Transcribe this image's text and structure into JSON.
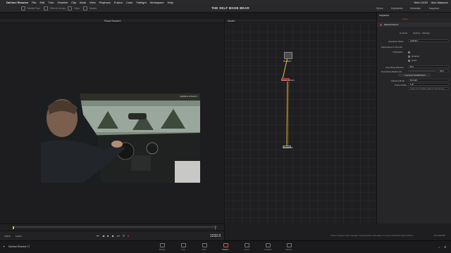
{
  "menubar": {
    "app": "DaVinci Resolve",
    "items": [
      "File",
      "Edit",
      "Trim",
      "Timeline",
      "Clip",
      "Mark",
      "View",
      "Playback",
      "Fusion",
      "Color",
      "Fairlight",
      "Workspace",
      "Help"
    ],
    "clock": "Wed 13:59",
    "user": "Alex Makarov"
  },
  "toolbar": {
    "media_pool": "Media Pool",
    "effects": "Effects Library",
    "clips": "Clips",
    "nodes": "Nodes",
    "project_title": "THE SELF MADE BEAR",
    "edited": "Edited",
    "right": [
      "Spline",
      "Keyframes",
      "Metadata",
      "Inspector"
    ]
  },
  "viewer": {
    "title": "PlanarTracker1",
    "tracker_label": "MediaIn1+PlanarT..."
  },
  "nodes": {
    "title": "Nodes",
    "items": [
      "MediaIn1",
      "PlanarTracker1",
      "MediaOut1"
    ]
  },
  "inspector": {
    "title": "Inspector",
    "tab_label": "Tools",
    "node_name": "PlanarTracker1",
    "subtabs": [
      "Controls",
      "Options",
      "Settings"
    ],
    "operation_mode_label": "Operation Mode",
    "operation_mode_value": "Stabilize",
    "section_label": "Parameters to Smooth",
    "params": [
      "Translation",
      "Rotation",
      "Scale"
    ],
    "smoothing_window_label": "Smoothing Window",
    "smoothing_window_value": "Box",
    "smoothing_radius_label": "Smoothing Radius (Fr...",
    "smoothing_radius_value": "30.0",
    "compute_btn": "Compute Stabilization",
    "clipping_mode_label": "Clipping Mode",
    "clipping_mode_value": "Domain",
    "frame_mode_label": "Frame Mode",
    "frame_mode_value": "Full",
    "note": "Apply the tracked data to fixed Fram..."
  },
  "transport": {
    "left_frames": [
      "1180.0",
      "1160.0"
    ],
    "timecode": "1232.0"
  },
  "status": {
    "text": "Frames rendered: 110.0, Average: 4.91 frames/sec, Time taken: 17.6 secs, Finished at: Wed 13:59:51",
    "right": "21%  4698 MB"
  },
  "pagebar": {
    "app_label": "DaVinci Resolve 17",
    "pages": [
      "Media",
      "Cut",
      "Edit",
      "Fusion",
      "Color",
      "Fairlight",
      "Deliver"
    ],
    "active_page": "Fusion"
  },
  "colors": {
    "accent": "#e85a28",
    "link": "#e8c23a",
    "selected": "#d33a3a"
  }
}
